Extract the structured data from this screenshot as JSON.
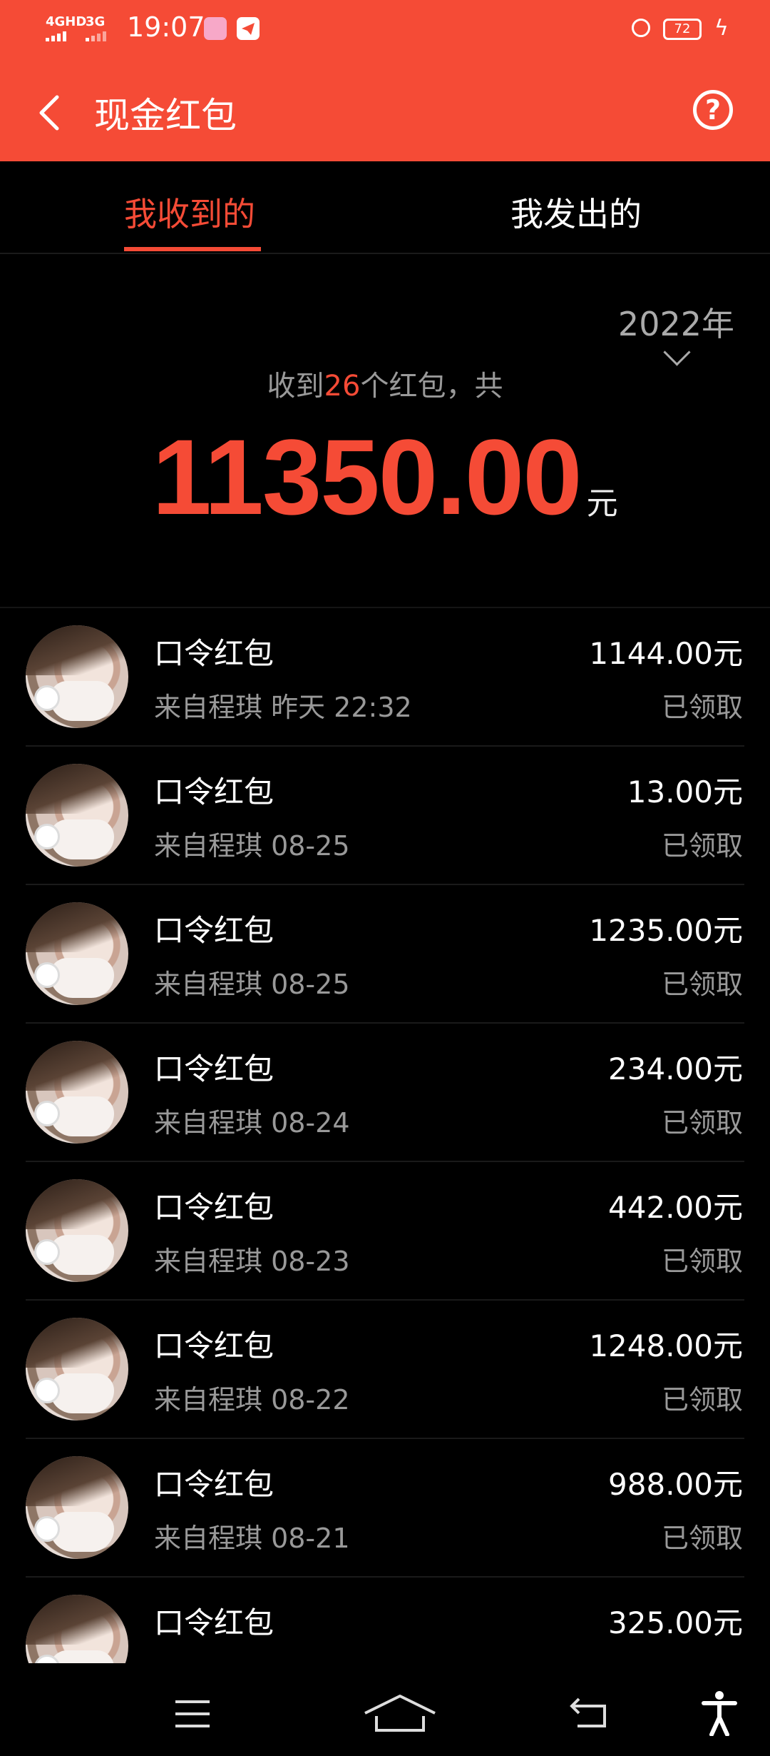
{
  "status_bar": {
    "network1": "4GHD",
    "network2": "3G",
    "time": "19:07",
    "battery": "72"
  },
  "header": {
    "title": "现金红包"
  },
  "tabs": [
    {
      "label": "我收到的",
      "active": true
    },
    {
      "label": "我发出的",
      "active": false
    }
  ],
  "summary": {
    "year": "2022年",
    "prefix": "收到",
    "count": "26",
    "suffix": "个红包，共",
    "total": "11350.00",
    "unit": "元"
  },
  "items": [
    {
      "title": "口令红包",
      "subtitle": "来自程琪 昨天 22:32",
      "amount": "1144.00元",
      "status": "已领取"
    },
    {
      "title": "口令红包",
      "subtitle": "来自程琪 08-25",
      "amount": "13.00元",
      "status": "已领取"
    },
    {
      "title": "口令红包",
      "subtitle": "来自程琪 08-25",
      "amount": "1235.00元",
      "status": "已领取"
    },
    {
      "title": "口令红包",
      "subtitle": "来自程琪 08-24",
      "amount": "234.00元",
      "status": "已领取"
    },
    {
      "title": "口令红包",
      "subtitle": "来自程琪 08-23",
      "amount": "442.00元",
      "status": "已领取"
    },
    {
      "title": "口令红包",
      "subtitle": "来自程琪 08-22",
      "amount": "1248.00元",
      "status": "已领取"
    },
    {
      "title": "口令红包",
      "subtitle": "来自程琪 08-21",
      "amount": "988.00元",
      "status": "已领取"
    },
    {
      "title": "口令红包",
      "subtitle": "",
      "amount": "325.00元",
      "status": ""
    }
  ],
  "colors": {
    "accent": "#f54b36",
    "background": "#000000",
    "muted": "#999999"
  },
  "icons": {
    "back": "chevron-left-icon",
    "help": "question-circle-icon",
    "nav_menu": "menu-icon",
    "nav_home": "home-icon",
    "nav_back": "back-icon",
    "nav_accessibility": "accessibility-icon"
  }
}
